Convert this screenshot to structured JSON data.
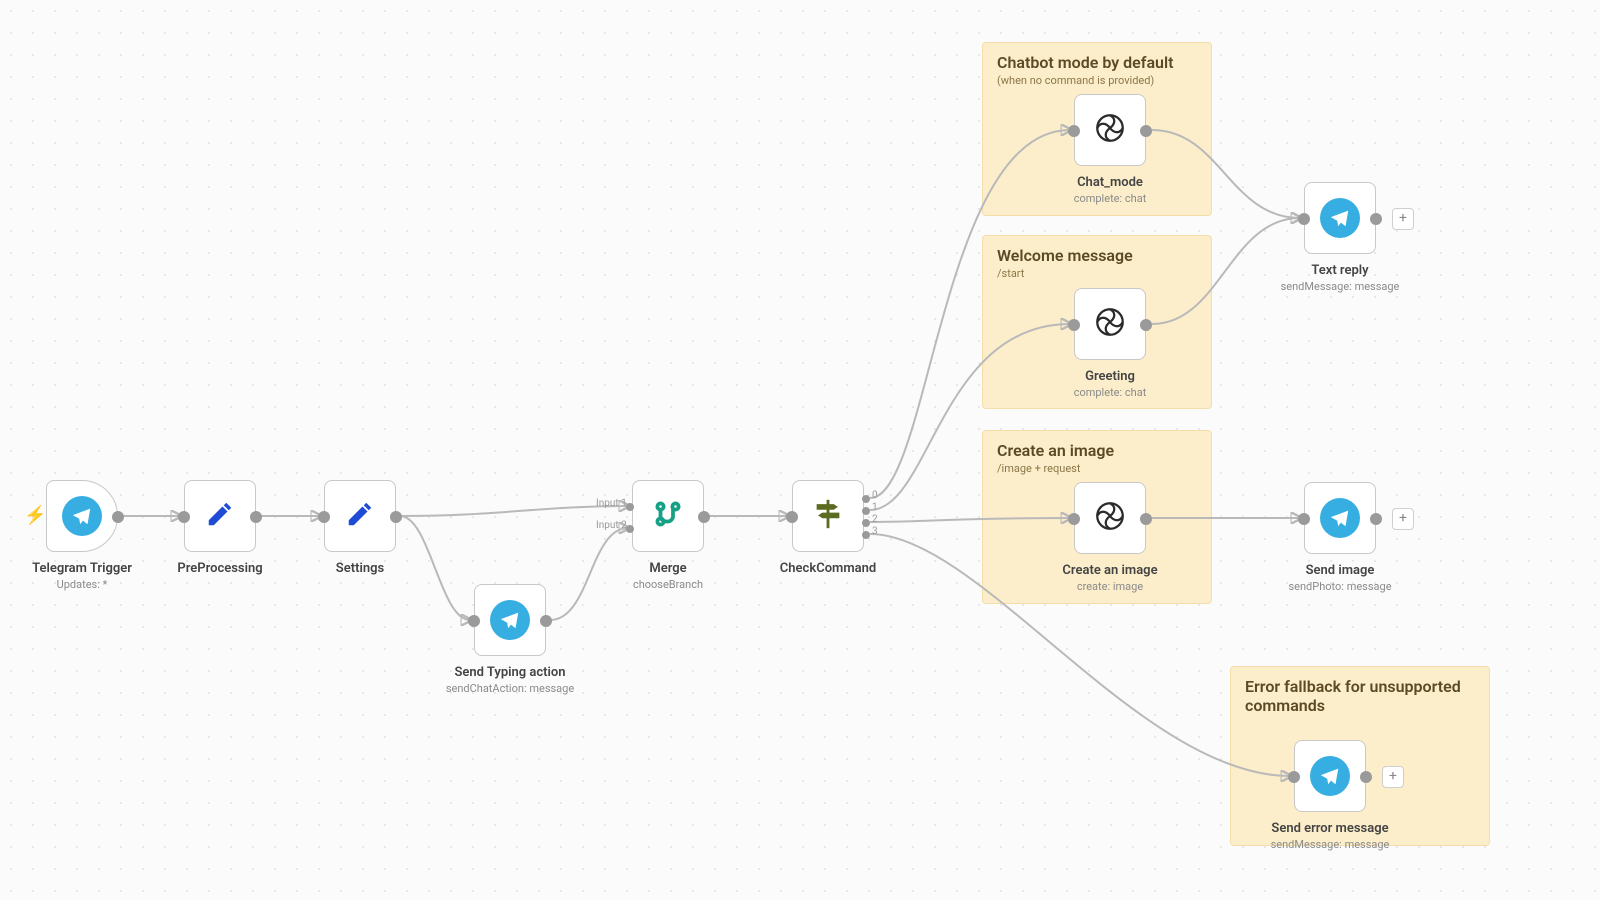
{
  "nodes": {
    "telegram_trigger": {
      "title": "Telegram Trigger",
      "sub": "Updates: *"
    },
    "preprocessing": {
      "title": "PreProcessing"
    },
    "settings": {
      "title": "Settings"
    },
    "send_typing": {
      "title": "Send Typing action",
      "sub": "sendChatAction: message"
    },
    "merge": {
      "title": "Merge",
      "sub": "chooseBranch",
      "inputs": [
        "Input 1",
        "Input 2"
      ]
    },
    "check_command": {
      "title": "CheckCommand",
      "outputs": [
        "0",
        "1",
        "2",
        "3"
      ]
    },
    "chat_mode": {
      "title": "Chat_mode",
      "sub": "complete: chat"
    },
    "greeting": {
      "title": "Greeting",
      "sub": "complete: chat"
    },
    "create_image": {
      "title": "Create an image",
      "sub": "create: image"
    },
    "text_reply": {
      "title": "Text reply",
      "sub": "sendMessage: message"
    },
    "send_image": {
      "title": "Send image",
      "sub": "sendPhoto: message"
    },
    "send_error": {
      "title": "Send error message",
      "sub": "sendMessage: message"
    }
  },
  "stickies": {
    "chatbot_default": {
      "title": "Chatbot mode by default",
      "desc": "(when no command is provided)"
    },
    "welcome": {
      "title": "Welcome message",
      "desc": "/start"
    },
    "create_image": {
      "title": "Create an image",
      "desc": "/image + request"
    },
    "error_fallback": {
      "title": "Error fallback for unsupported commands",
      "desc": ""
    }
  }
}
